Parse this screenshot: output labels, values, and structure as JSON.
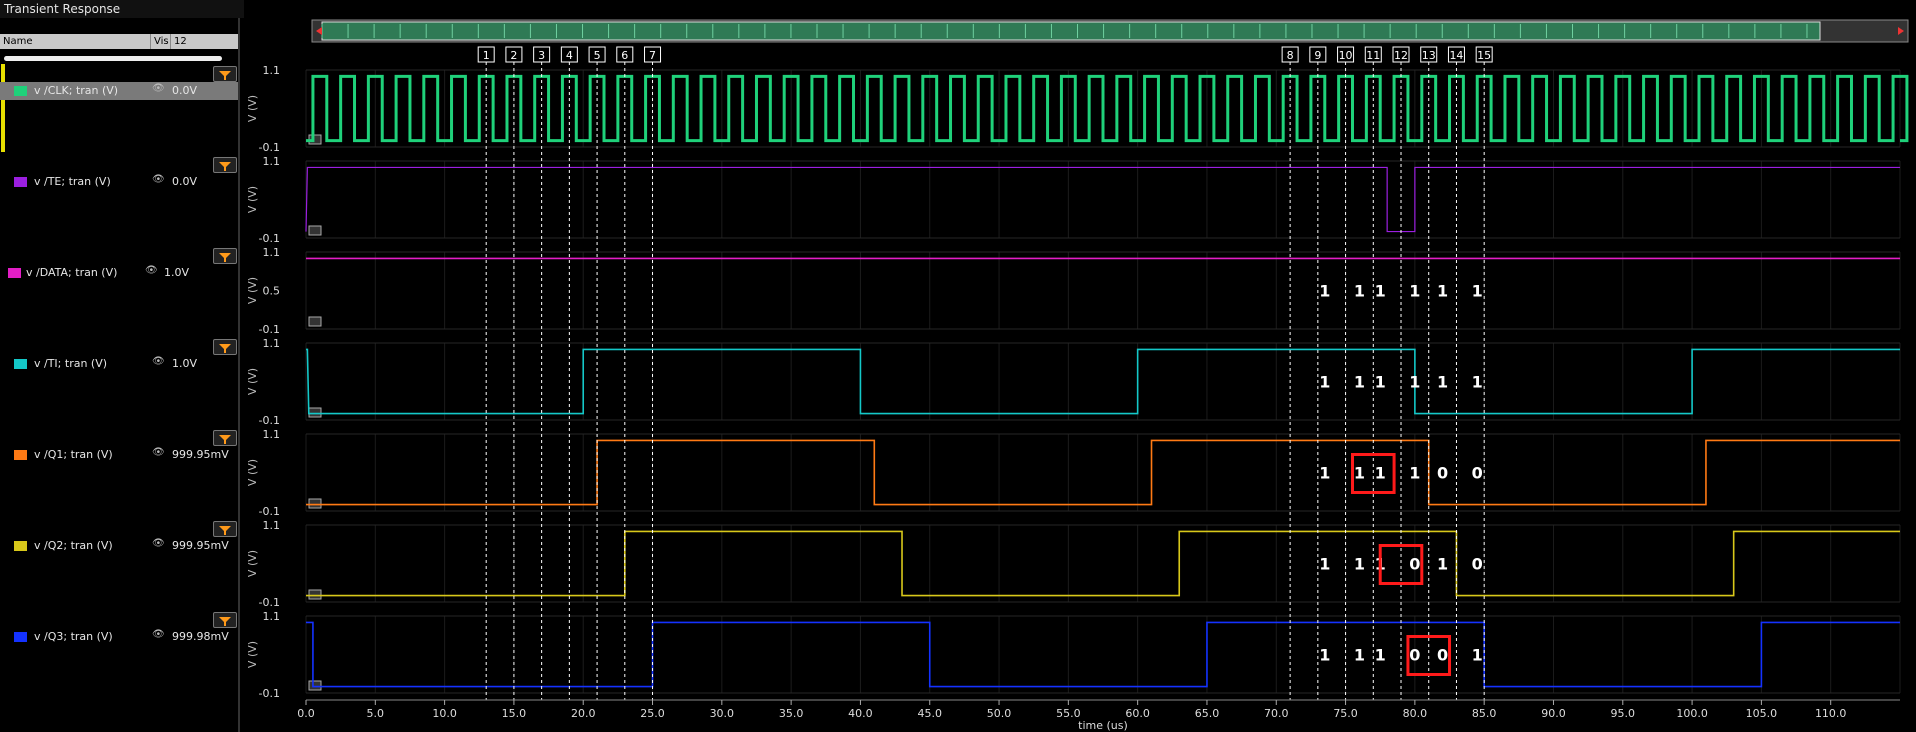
{
  "window": {
    "title": "Transient Response"
  },
  "columns": {
    "name": "Name",
    "vis": "Vis",
    "count": "12"
  },
  "signals": [
    {
      "name": "v /CLK; tran (V)",
      "value": "0.0V",
      "color": "#1fd17a"
    },
    {
      "name": "v /TE; tran (V)",
      "value": "0.0V",
      "color": "#9b1fe0"
    },
    {
      "name": "v /DATA; tran (V)",
      "value": "1.0V",
      "color": "#e31ec6"
    },
    {
      "name": "v /TI; tran (V)",
      "value": "1.0V",
      "color": "#14c8c8"
    },
    {
      "name": "v /Q1; tran (V)",
      "value": "999.95mV",
      "color": "#ff7a14"
    },
    {
      "name": "v /Q2; tran (V)",
      "value": "999.95mV",
      "color": "#d8c81a"
    },
    {
      "name": "v /Q3; tran (V)",
      "value": "999.98mV",
      "color": "#1432ff"
    }
  ],
  "axes": {
    "y_label": "V (V)",
    "x_label": "time (us)",
    "x_ticks": [
      "0.0",
      "5.0",
      "10.0",
      "15.0",
      "20.0",
      "25.0",
      "30.0",
      "35.0",
      "40.0",
      "45.0",
      "50.0",
      "55.0",
      "60.0",
      "65.0",
      "70.0",
      "75.0",
      "80.0",
      "85.0",
      "90.0",
      "95.0",
      "100.0",
      "105.0",
      "110.0"
    ],
    "y_top": "1.1",
    "y_bottom": "-0.1",
    "y_mid_data": "0.5"
  },
  "markers": {
    "labels": [
      "1",
      "2",
      "3",
      "4",
      "5",
      "6",
      "7",
      "8",
      "9",
      "10",
      "11",
      "12",
      "13",
      "14",
      "15"
    ],
    "times": [
      13,
      15,
      17,
      19,
      21,
      23,
      25,
      71,
      73,
      75,
      77,
      79,
      81,
      83,
      85
    ]
  },
  "chart_data": {
    "type": "line",
    "xlim": [
      0,
      115
    ],
    "ylim": [
      -0.1,
      1.1
    ],
    "clock_period_us": 2,
    "series": [
      {
        "name": "v /CLK; tran (V)",
        "note": "square wave 0 to 1.0 V"
      },
      {
        "name": "v /TE; tran (V)",
        "x": [
          0,
          0.1,
          78,
          78,
          80,
          80,
          115
        ],
        "y": [
          0,
          1,
          1,
          0,
          0,
          1,
          1
        ]
      },
      {
        "name": "v /DATA; tran (V)",
        "x": [
          0,
          115
        ],
        "y": [
          1,
          1
        ]
      },
      {
        "name": "v /TI; tran (V)",
        "x": [
          0,
          0.1,
          0.2,
          20,
          20,
          40,
          40,
          60,
          60,
          80,
          80,
          100,
          100,
          115
        ],
        "y": [
          1,
          1,
          0,
          0,
          1,
          1,
          0,
          0,
          1,
          1,
          0,
          0,
          1,
          1
        ]
      },
      {
        "name": "v /Q1; tran (V)",
        "x": [
          0,
          21,
          21,
          41,
          41,
          61,
          61,
          81,
          81,
          101,
          101,
          115
        ],
        "y": [
          0,
          0,
          1,
          1,
          0,
          0,
          1,
          1,
          0,
          0,
          1,
          1
        ]
      },
      {
        "name": "v /Q2; tran (V)",
        "x": [
          0,
          23,
          23,
          43,
          43,
          63,
          63,
          83,
          83,
          103,
          103,
          115
        ],
        "y": [
          0,
          0,
          1,
          1,
          0,
          0,
          1,
          1,
          0,
          0,
          1,
          1
        ]
      },
      {
        "name": "v /Q3; tran (V)",
        "x": [
          0,
          0.5,
          0.5,
          25,
          25,
          45,
          45,
          65,
          65,
          85,
          85,
          105,
          105,
          115
        ],
        "y": [
          1,
          1,
          0,
          0,
          1,
          1,
          0,
          0,
          1,
          1,
          0,
          0,
          1,
          1
        ]
      }
    ]
  },
  "annotations": [
    {
      "row": 2,
      "texts": [
        {
          "t": 73.5,
          "v": "1"
        },
        {
          "t": 76,
          "v": "1"
        },
        {
          "t": 77.5,
          "v": "1"
        },
        {
          "t": 80,
          "v": "1"
        },
        {
          "t": 82,
          "v": "1"
        },
        {
          "t": 84.5,
          "v": "1"
        }
      ]
    },
    {
      "row": 3,
      "texts": [
        {
          "t": 73.5,
          "v": "1"
        },
        {
          "t": 76,
          "v": "1"
        },
        {
          "t": 77.5,
          "v": "1"
        },
        {
          "t": 80,
          "v": "1"
        },
        {
          "t": 82,
          "v": "1"
        },
        {
          "t": 84.5,
          "v": "1"
        }
      ]
    },
    {
      "row": 4,
      "texts": [
        {
          "t": 73.5,
          "v": "1"
        },
        {
          "t": 76,
          "v": "1"
        },
        {
          "t": 77.5,
          "v": "1"
        },
        {
          "t": 80,
          "v": "1"
        },
        {
          "t": 82,
          "v": "0"
        },
        {
          "t": 84.5,
          "v": "0"
        }
      ]
    },
    {
      "row": 5,
      "texts": [
        {
          "t": 73.5,
          "v": "1"
        },
        {
          "t": 76,
          "v": "1"
        },
        {
          "t": 77.5,
          "v": "1"
        },
        {
          "t": 80,
          "v": "0"
        },
        {
          "t": 82,
          "v": "1"
        },
        {
          "t": 84.5,
          "v": "0"
        }
      ]
    },
    {
      "row": 6,
      "texts": [
        {
          "t": 73.5,
          "v": "1"
        },
        {
          "t": 76,
          "v": "1"
        },
        {
          "t": 77.5,
          "v": "1"
        },
        {
          "t": 80,
          "v": "0"
        },
        {
          "t": 82,
          "v": "0"
        },
        {
          "t": 84.5,
          "v": "1"
        }
      ]
    }
  ],
  "highlights": [
    {
      "row": 4,
      "t0": 75.5,
      "t1": 78.5
    },
    {
      "row": 5,
      "t0": 77.5,
      "t1": 80.5
    },
    {
      "row": 6,
      "t0": 79.5,
      "t1": 82.5
    }
  ],
  "colors": {
    "background": "#000000",
    "grid": "#1c1c1c",
    "marker": "#ffffff",
    "highlight": "#ff1a1a"
  }
}
